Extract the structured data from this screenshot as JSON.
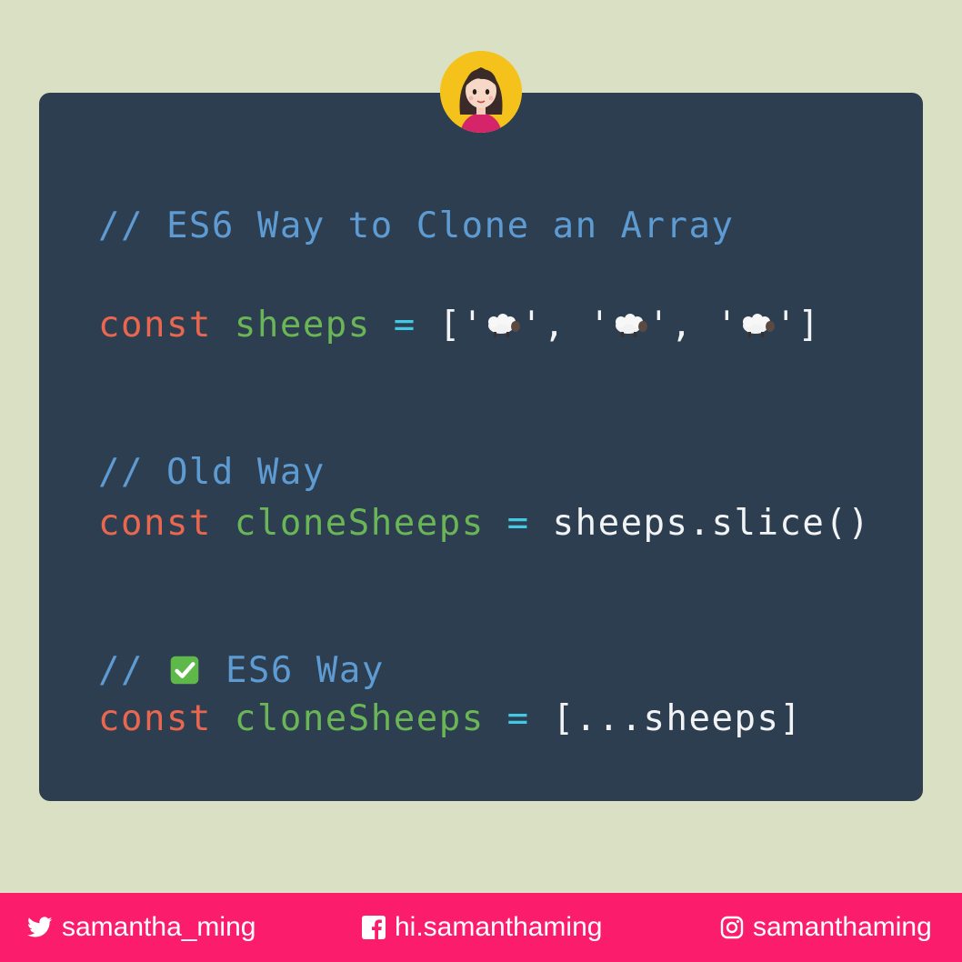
{
  "code": {
    "comment1": "// ES6 Way to Clone an Array",
    "line1": {
      "kw": "const",
      "var": "sheeps",
      "op": "=",
      "open": "['",
      "sep1": "', '",
      "sep2": "', '",
      "close": "']",
      "item_icon": "sheep-emoji"
    },
    "comment2": "// Old Way",
    "line2": {
      "kw": "const",
      "var": "cloneSheeps",
      "op": "=",
      "rhs": "sheeps.slice()"
    },
    "comment3_prefix": "//",
    "comment3_icon": "check-mark-emoji",
    "comment3_text": "ES6 Way",
    "line3": {
      "kw": "const",
      "var": "cloneSheeps",
      "op": "=",
      "rhs": "[...sheeps]"
    }
  },
  "footer": {
    "twitter": "samantha_ming",
    "facebook": "hi.samanthaming",
    "instagram": "samanthaming"
  },
  "colors": {
    "background": "#dae0c4",
    "card": "#2d3e50",
    "comment": "#5d9bd2",
    "keyword": "#e9674f",
    "variable": "#6ab556",
    "operator": "#44c9e4",
    "footer": "#fb1d6c"
  }
}
